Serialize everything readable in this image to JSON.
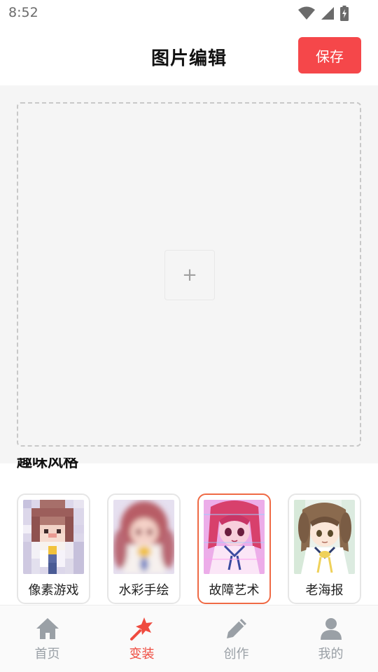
{
  "status_bar": {
    "time": "8:52"
  },
  "header": {
    "title": "图片编辑",
    "save_label": "保存"
  },
  "canvas": {
    "add_symbol": "+"
  },
  "styles_section": {
    "title": "趣味风格",
    "items": [
      {
        "label": "像素游戏",
        "selected": false
      },
      {
        "label": "水彩手绘",
        "selected": false
      },
      {
        "label": "故障艺术",
        "selected": true
      },
      {
        "label": "老海报",
        "selected": false
      }
    ]
  },
  "tab_bar": {
    "items": [
      {
        "label": "首页",
        "icon": "home-icon",
        "active": false
      },
      {
        "label": "变装",
        "icon": "magic-wand-icon",
        "active": true
      },
      {
        "label": "创作",
        "icon": "pencil-icon",
        "active": false
      },
      {
        "label": "我的",
        "icon": "user-icon",
        "active": false
      }
    ]
  },
  "colors": {
    "accent": "#f5474a",
    "selected_border": "#ef6a45",
    "tab_active": "#ef4b3f",
    "tab_inactive": "#9aa0a6"
  }
}
